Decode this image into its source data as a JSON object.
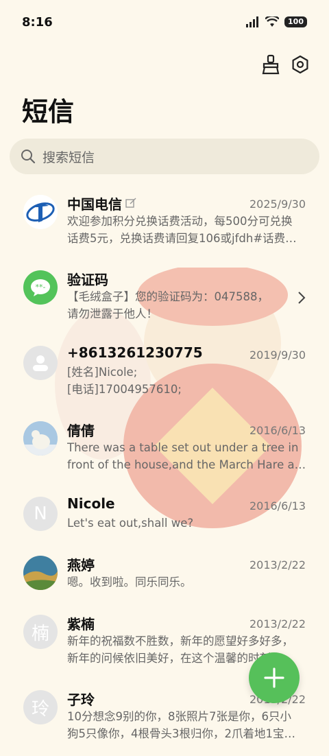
{
  "status": {
    "time": "8:16",
    "battery": "100"
  },
  "header": {
    "title": "短信"
  },
  "search": {
    "placeholder": "搜索短信"
  },
  "messages": [
    {
      "name": "中国电信",
      "date": "2025/9/30",
      "line1": "欢迎参加积分兑换话费活动，每500分可兑换",
      "line2": "话费5元，兑换话费请回复106或jfdh#话费…",
      "avatar": "telecom-logo"
    },
    {
      "name": "验证码",
      "date": "",
      "line1": "【毛绒盒子】您的验证码为：047588，",
      "line2": "请勿泄露于他人！",
      "avatar": "message-icon"
    },
    {
      "name": "+8613261230775",
      "date": "2019/9/30",
      "line1": "[姓名]Nicole;",
      "line2": "[电话]17004957610;",
      "avatar": "person-icon"
    },
    {
      "name": "倩倩",
      "date": "2016/6/13",
      "line1": "There was a table set out under a tree in",
      "line2": "front of the house,and the March Hare an…",
      "avatar": "polar-bear-photo"
    },
    {
      "name": "Nicole",
      "date": "2016/6/13",
      "line1": "Let's eat out,shall we?",
      "line2": "",
      "avatar_letter": "N"
    },
    {
      "name": "燕婷",
      "date": "2013/2/22",
      "line1": "嗯。收到啦。同乐同乐。",
      "line2": "",
      "avatar": "landscape-photo"
    },
    {
      "name": "紫楠",
      "date": "2013/2/22",
      "line1": "新年的祝福数不胜数，新年的愿望好多好多，",
      "line2": "新年的问候依旧美好，在这个温馨的时刻…",
      "avatar_letter": "楠"
    },
    {
      "name": "子玲",
      "date": "2013/2/22",
      "line1": "10分想念9别的你，8张照片7张是你，6只小",
      "line2": "狗5只像你，4根骨头3根归你，2爪着地1宝…",
      "avatar_letter": "玲"
    }
  ],
  "colors": {
    "background": "#fdf8ec",
    "accent": "#56c05a",
    "search_bg": "#efeadb"
  }
}
